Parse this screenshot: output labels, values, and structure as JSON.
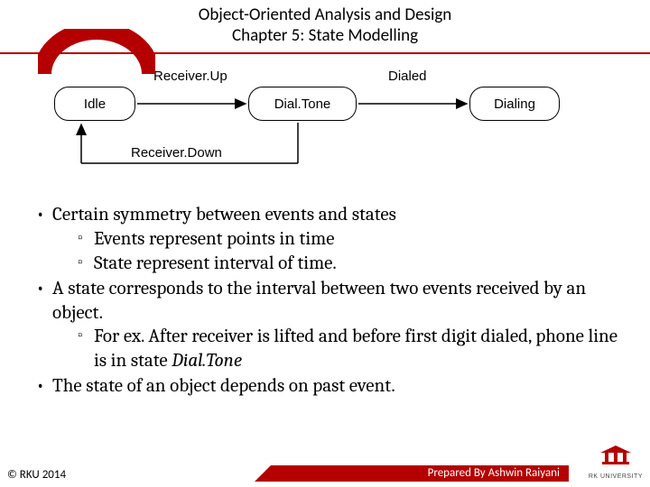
{
  "header": {
    "title_line1": "Object-Oriented Analysis and Design",
    "title_line2": "Chapter 5: State Modelling"
  },
  "diagram": {
    "states": [
      "Idle",
      "Dial.Tone",
      "Dialing"
    ],
    "transitions": {
      "receiver_up": "Receiver.Up",
      "dialed": "Dialed",
      "receiver_down": "Receiver.Down"
    }
  },
  "bullets": {
    "b1": "Certain symmetry between events and states",
    "b1_sub1": "Events represent points in time",
    "b1_sub2": "State represent interval of time.",
    "b2": "A state corresponds to the interval between two events received by an object.",
    "b2_sub1_pre": "For ex. After receiver is lifted and before first digit dialed, phone line is in state ",
    "b2_sub1_ital": "Dial.Tone",
    "b3": "The state of an object depends on past event."
  },
  "footer": {
    "copyright": "© RKU 2014",
    "prepared": "Prepared By Ashwin Raiyani",
    "logo": "RK UNIVERSITY"
  }
}
